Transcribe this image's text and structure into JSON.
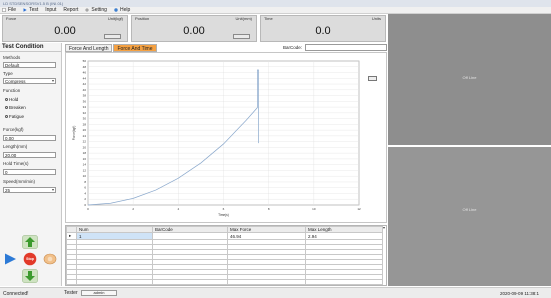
{
  "window": {
    "title": "LD STDSENSORSV1.5 B (INI.01)"
  },
  "menu": {
    "items": [
      {
        "label": "File",
        "icon": "file-icon"
      },
      {
        "label": "Test",
        "icon": "play-icon"
      },
      {
        "label": "Input",
        "icon": ""
      },
      {
        "label": "Report",
        "icon": ""
      },
      {
        "label": "Setting",
        "icon": "gear-icon"
      },
      {
        "label": "Help",
        "icon": "help-icon"
      }
    ]
  },
  "readouts": {
    "force": {
      "label": "Force",
      "unit": "Unit(kgf)",
      "value": "0.00"
    },
    "position": {
      "label": "Position",
      "unit": "Unit(mm)",
      "value": "0.00"
    },
    "time": {
      "label": "Time",
      "unit": "Units",
      "value": "0.0"
    }
  },
  "camera": {
    "top_label": "Off Line",
    "bottom_label": "Off Line"
  },
  "sidebar": {
    "title": "Test Condition",
    "methods_label": "Methods",
    "methods_value": "Default",
    "type_label": "Type",
    "type_value": "Compress",
    "function_label": "Function",
    "functions": [
      {
        "label": "Hold",
        "checked": false
      },
      {
        "label": "Breaken",
        "checked": true
      },
      {
        "label": "Fatigue",
        "checked": false
      }
    ],
    "force_label": "Force(kgf)",
    "force_value": "0.00",
    "length_label": "Length(mm)",
    "length_value": "20.00",
    "hold_label": "Hold Time(s)",
    "hold_value": "0",
    "speed_label": "Speed(mm/min)",
    "speed_value": "25"
  },
  "controls": {
    "stop_label": "Stop"
  },
  "tabs": [
    {
      "label": "Force And Length",
      "active": false
    },
    {
      "label": "Force And Time",
      "active": true
    }
  ],
  "barcode": {
    "label": "BarCode:",
    "value": ""
  },
  "chart_data": {
    "type": "line",
    "title": "",
    "xlabel": "Time(s)",
    "ylabel": "Force(kgf)",
    "xlim": [
      0,
      12
    ],
    "ylim": [
      0,
      50
    ],
    "xticks": [
      0,
      2,
      4,
      6,
      8,
      10,
      12
    ],
    "yticks": [
      0,
      2,
      4,
      6,
      8,
      10,
      12,
      14,
      16,
      18,
      20,
      22,
      24,
      26,
      28,
      30,
      32,
      34,
      36,
      38,
      40,
      42,
      44,
      46,
      48,
      50
    ],
    "grid": true,
    "color": "#8aa8cc",
    "series": [
      {
        "x": [
          0,
          1,
          2,
          3,
          4,
          5,
          6,
          7,
          7.5,
          7.5,
          7.55,
          7.55
        ],
        "y": [
          0,
          0.6,
          2.3,
          5.2,
          9.3,
          14.6,
          21.2,
          29.4,
          33.8,
          46.9,
          46.9,
          21.5
        ]
      }
    ]
  },
  "table": {
    "columns": [
      "Num",
      "BarCode",
      "Max Force",
      "Max Length"
    ],
    "rows": [
      [
        "1",
        "",
        "46.94",
        "2.94"
      ]
    ],
    "empty_rows": 9,
    "marker": "▸"
  },
  "status": {
    "left": "Connected!",
    "user_label": "Tester",
    "user_value": "admin",
    "datetime": "2020-09-09 11:38:1"
  }
}
